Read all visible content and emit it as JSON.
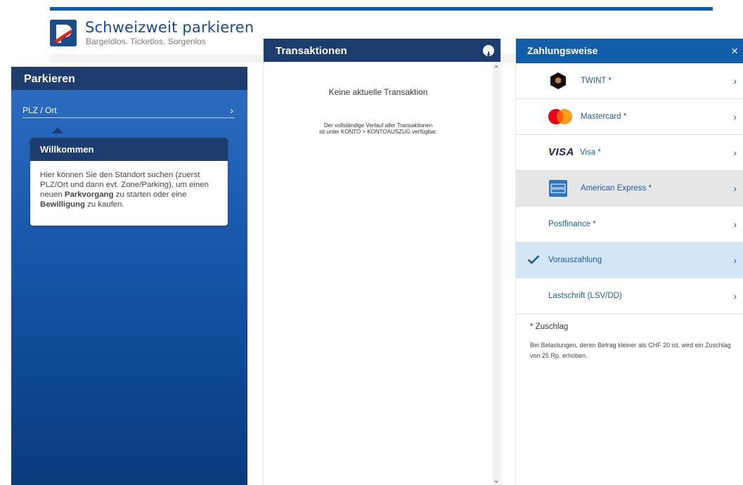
{
  "header": {
    "title": "Schweizweit parkieren",
    "subtitle": "Bargeldlos. Ticketlos. Sorgenlos",
    "brand_color": "#1a4b8c",
    "accent_color": "#0e5aa7"
  },
  "parkieren": {
    "title": "Parkieren",
    "location_field": "PLZ / Ort",
    "welcome": {
      "title": "Willkommen",
      "text_1": "Hier können Sie den Standort suchen (zuerst PLZ/Ort und dann evt. Zone/Parking), um einen neuen ",
      "bold_1": "Parkvorgang",
      "text_2": " zu starten oder eine ",
      "bold_2": "Bewilligung",
      "text_3": " zu kaufen."
    }
  },
  "transaktionen": {
    "title": "Transaktionen",
    "empty": "Keine aktuelle Transaktion",
    "note_line1": "Der vollständige Verlauf aller Transaktionen",
    "note_line2": "ist unter KONTO > KONTOAUSZUG verfügbar.",
    "download_icon": "download-icon"
  },
  "zahlungsweise": {
    "title": "Zahlungsweise",
    "close": "×",
    "methods": [
      {
        "label": "TWINT *",
        "icon": "twint-icon",
        "state": "default"
      },
      {
        "label": "Mastercard *",
        "icon": "mastercard-icon",
        "state": "default"
      },
      {
        "label": "Visa *",
        "icon": "visa-icon",
        "logo_text": "VISA",
        "state": "default"
      },
      {
        "label": "American Express *",
        "icon": "amex-icon",
        "state": "hover"
      },
      {
        "label": "Postfinance *",
        "icon": null,
        "state": "default"
      },
      {
        "label": "Vorauszahlung",
        "icon": "checkmark-icon",
        "state": "selected"
      },
      {
        "label": "Lastschrift (LSV/DD)",
        "icon": null,
        "state": "default"
      }
    ],
    "surcharge_title": "* Zuschlag",
    "surcharge_text": "Bei Belastungen, deren Betrag kleiner als CHF 20 ist, wird ein Zuschlag von 25 Rp. erhoben.",
    "selected_color": "#d3e6f6",
    "header_color": "#135ea8"
  }
}
